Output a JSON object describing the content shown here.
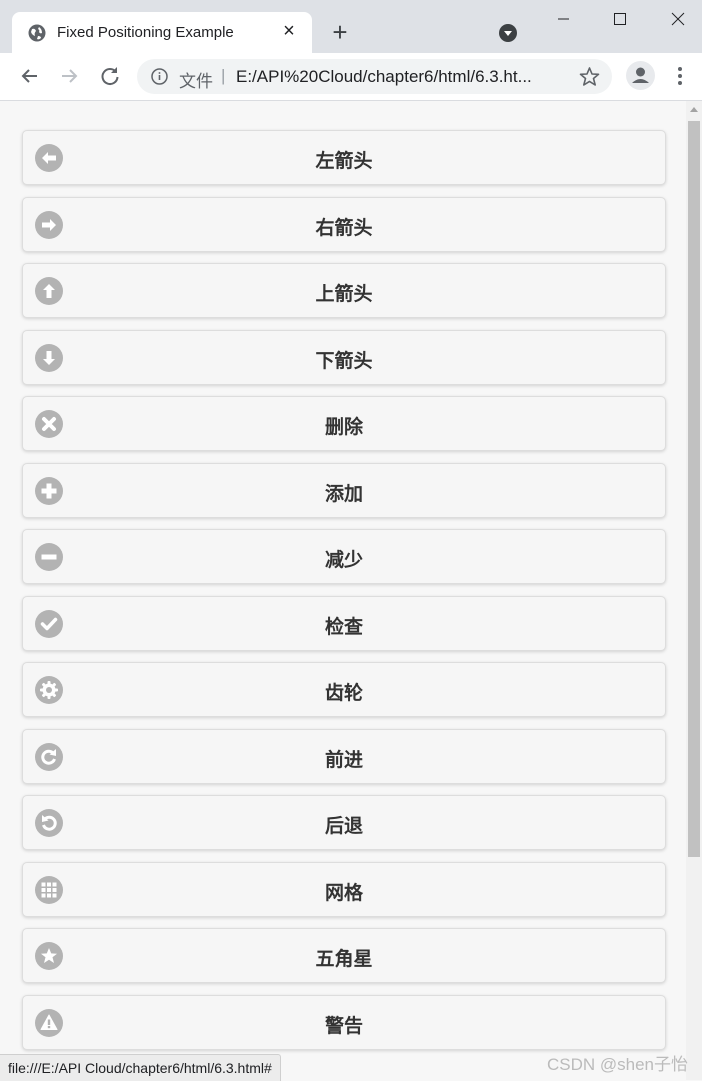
{
  "browser": {
    "tab_title": "Fixed Positioning Example",
    "tab_close": "×",
    "new_tab": "+",
    "scheme_label": "文件",
    "url_separator": "|",
    "url": "E:/API%20Cloud/chapter6/html/6.3.ht...",
    "status_url": "file:///E:/API Cloud/chapter6/html/6.3.html#"
  },
  "buttons": [
    {
      "label": "左箭头",
      "icon": "arrow-l-icon"
    },
    {
      "label": "右箭头",
      "icon": "arrow-r-icon"
    },
    {
      "label": "上箭头",
      "icon": "arrow-u-icon"
    },
    {
      "label": "下箭头",
      "icon": "arrow-d-icon"
    },
    {
      "label": "删除",
      "icon": "delete-icon"
    },
    {
      "label": "添加",
      "icon": "plus-icon"
    },
    {
      "label": "减少",
      "icon": "minus-icon"
    },
    {
      "label": "检查",
      "icon": "check-icon"
    },
    {
      "label": "齿轮",
      "icon": "gear-icon"
    },
    {
      "label": "前进",
      "icon": "forward-icon"
    },
    {
      "label": "后退",
      "icon": "back-icon"
    },
    {
      "label": "网格",
      "icon": "grid-icon"
    },
    {
      "label": "五角星",
      "icon": "star-icon"
    },
    {
      "label": "警告",
      "icon": "alert-icon"
    }
  ],
  "watermark": "CSDN @shen子怡",
  "colors": {
    "icon_disc": "#b3b3b3",
    "button_bg": "#f6f6f6",
    "label": "#333333"
  }
}
